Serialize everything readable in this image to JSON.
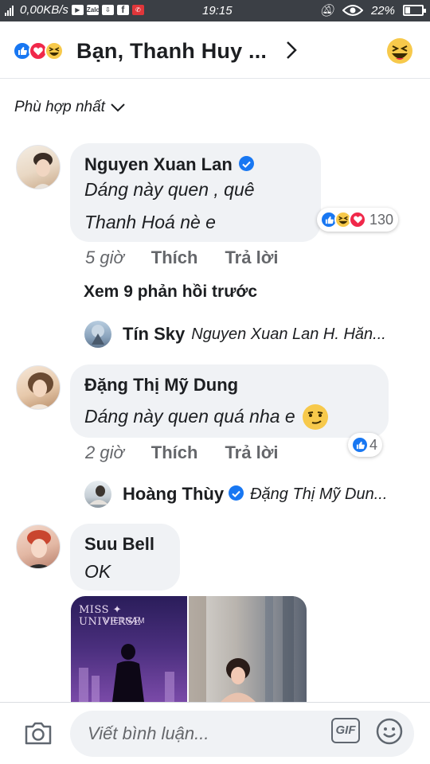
{
  "status_bar": {
    "speed": "0,00KB/s",
    "time": "19:15",
    "battery": "22%"
  },
  "header": {
    "title": "Bạn, Thanh Huy ..."
  },
  "sort": {
    "label": "Phù hợp nhất"
  },
  "comments": [
    {
      "name": "Nguyen Xuan Lan",
      "verified": true,
      "text_lines": [
        "Dáng này quen , quê",
        "Thanh Hoá nè e"
      ],
      "time": "5 giờ",
      "like_label": "Thích",
      "reply_label": "Trả lời",
      "reaction_count": "130"
    },
    {
      "name": "Đặng Thị Mỹ Dung",
      "verified": false,
      "text_lines": [
        "Dáng này quen quá nha e"
      ],
      "time": "2 giờ",
      "like_label": "Thích",
      "reply_label": "Trả lời",
      "reaction_count": "4"
    },
    {
      "name": "Suu Bell",
      "verified": false,
      "text_lines": [
        "OK"
      ]
    }
  ],
  "see_previous": "Xem 9 phản hồi trước",
  "replies": [
    {
      "name": "Tín Sky",
      "text": "Nguyen Xuan Lan H. Hăn..."
    },
    {
      "name": "Hoàng Thùy",
      "text": "Đặng Thị Mỹ Dun..."
    }
  ],
  "photos": {
    "p1_brand": "MISS ✦ UNIVERSE",
    "p1_sub": "VIETNAM"
  },
  "composer": {
    "placeholder": "Viết bình luận...",
    "gif_label": "GIF"
  },
  "colors": {
    "like_blue": "#1877f2",
    "love_red": "#f0284a",
    "bubble_gray": "#f0f2f5",
    "meta_gray": "#65676b"
  }
}
